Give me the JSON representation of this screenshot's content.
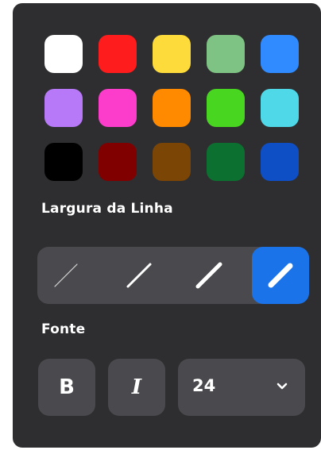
{
  "colors": [
    {
      "name": "white",
      "hex": "#ffffff"
    },
    {
      "name": "red",
      "hex": "#ff1c1c"
    },
    {
      "name": "yellow",
      "hex": "#fddb3a"
    },
    {
      "name": "light-green",
      "hex": "#7fc384"
    },
    {
      "name": "blue",
      "hex": "#2f8bff"
    },
    {
      "name": "purple",
      "hex": "#b779f7"
    },
    {
      "name": "magenta",
      "hex": "#fc3ccb"
    },
    {
      "name": "orange",
      "hex": "#ff8a00"
    },
    {
      "name": "green",
      "hex": "#49d621"
    },
    {
      "name": "cyan",
      "hex": "#4fd8e8"
    },
    {
      "name": "black",
      "hex": "#000000"
    },
    {
      "name": "dark-red",
      "hex": "#800000"
    },
    {
      "name": "brown",
      "hex": "#7a4505"
    },
    {
      "name": "dark-green",
      "hex": "#0c7030"
    },
    {
      "name": "dark-blue",
      "hex": "#0f4fc6"
    }
  ],
  "line_width": {
    "label": "Largura da Linha",
    "options": [
      "thin",
      "medium",
      "thick",
      "extra-thick"
    ],
    "selected": "extra-thick",
    "accent_color": "#1a73e8"
  },
  "font": {
    "label": "Fonte",
    "bold_label": "B",
    "italic_label": "I",
    "size_value": "24"
  }
}
